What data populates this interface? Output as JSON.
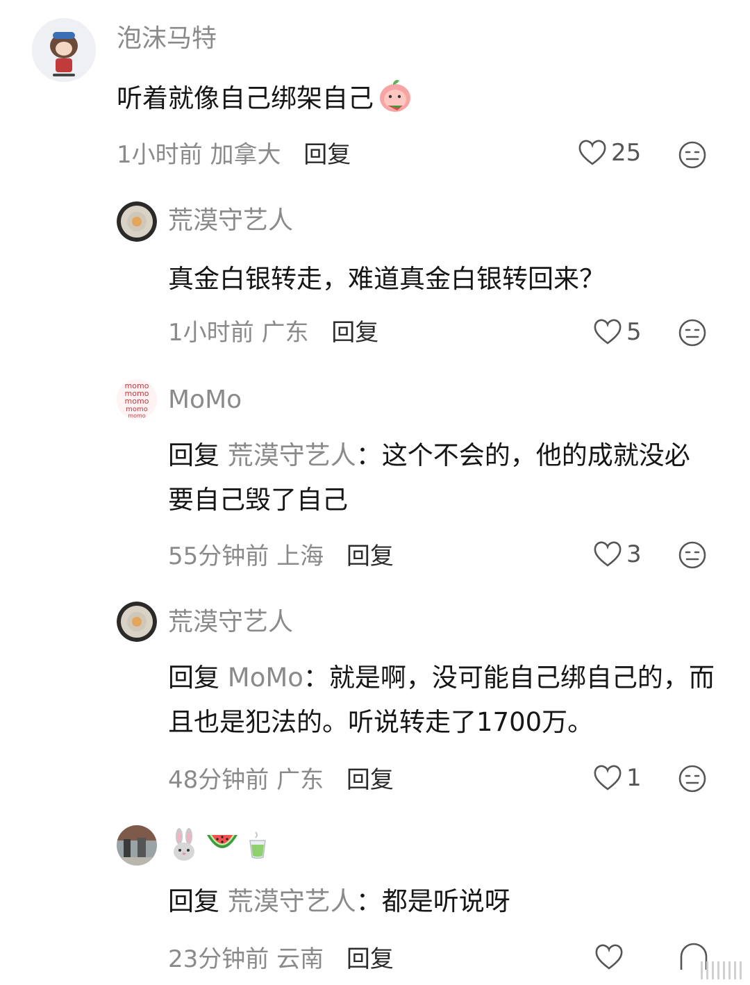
{
  "comments": [
    {
      "username": "泡沫马特",
      "text": "听着就像自己绑架自己",
      "time": "1小时前",
      "location": "加拿大",
      "reply_label": "回复",
      "likes": "25",
      "text_emoji": "peach-emoji"
    },
    {
      "username": "荒漠守艺人",
      "text": "真金白银转走，难道真金白银转回来？",
      "time": "1小时前",
      "location": "广东",
      "reply_label": "回复",
      "likes": "5"
    },
    {
      "username": "MoMo",
      "reply_prefix": "回复",
      "reply_to": "荒漠守艺人",
      "text": "：这个不会的，他的成就没必要自己毁了自己",
      "time": "55分钟前",
      "location": "上海",
      "reply_label": "回复",
      "likes": "3"
    },
    {
      "username": "荒漠守艺人",
      "reply_prefix": "回复",
      "reply_to": "MoMo",
      "text": "：就是啊，没可能自己绑自己的，而且也是犯法的。听说转走了1700万。",
      "time": "48分钟前",
      "location": "广东",
      "reply_label": "回复",
      "likes": "1"
    },
    {
      "username_emojis": [
        "rabbit-emoji",
        "watermelon-emoji",
        "tea-emoji"
      ],
      "reply_prefix": "回复",
      "reply_to": "荒漠守艺人",
      "text": "：都是听说呀",
      "time": "23分钟前",
      "location": "云南",
      "reply_label": "回复",
      "likes": ""
    }
  ],
  "avatar_text": {
    "momo": "momo"
  },
  "colors": {
    "text": "#161616",
    "secondary": "#8a8a8a",
    "icon": "#555555"
  }
}
